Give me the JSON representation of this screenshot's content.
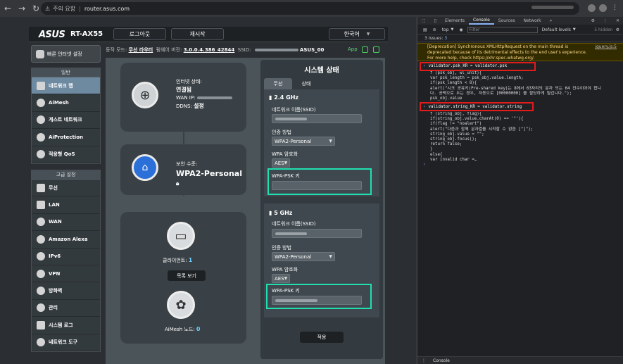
{
  "browser": {
    "security_label": "주의 요함",
    "url": "router.asus.com"
  },
  "router": {
    "brand": "ASUS",
    "model": "RT-AX55",
    "logout": "로그아웃",
    "reboot": "재시작",
    "language": "한국어",
    "status": {
      "mode_label": "동작 모드:",
      "mode_value": "무선 라우터",
      "fw_label": "펌웨어 버전:",
      "fw_value": "3.0.0.4.386_42844",
      "ssid_label": "SSID:",
      "ssid_value": "ASUS_00",
      "app": "App"
    },
    "quick_setup": "빠른 인터넷 설정",
    "general_header": "일반",
    "general_items": [
      "네트워크 맵",
      "AiMesh",
      "게스트 네트워크",
      "AiProtection",
      "적응형 QoS"
    ],
    "advanced_header": "고급 설정",
    "advanced_items": [
      "무선",
      "LAN",
      "WAN",
      "Amazon Alexa",
      "IPv6",
      "VPN",
      "방화벽",
      "관리",
      "시스템 로그",
      "네트워크 도구"
    ],
    "map": {
      "internet_status_label": "인터넷 상태:",
      "internet_status_value": "연결됨",
      "wan_ip_label": "WAN IP:",
      "ddns_label": "DDNS:",
      "ddns_value": "설정",
      "security_label": "보안 수준:",
      "security_value": "WPA2-Personal",
      "clients_label": "클라이언트:",
      "clients_value": "1",
      "list_button": "목록 보기",
      "aimesh_label": "AiMesh 노드:",
      "aimesh_value": "0"
    },
    "sys": {
      "title": "시스템 상태",
      "tab_wireless": "무선",
      "tab_status": "상태",
      "band24": "2.4 GHz",
      "band5": "5 GHz",
      "ssid_label": "네트워크 이름(SSID)",
      "auth_label": "인증 방법",
      "auth_value": "WPA2-Personal",
      "enc_label": "WPA 암호화",
      "enc_value": "AES",
      "psk_label": "WPA-PSK 키",
      "apply": "적용"
    }
  },
  "devtools": {
    "tabs": [
      "Elements",
      "Console",
      "Sources",
      "Network"
    ],
    "context": "top",
    "filter_placeholder": "Filter",
    "levels": "Default levels",
    "hidden": "5 hidden",
    "issues_label": "3 Issues:",
    "issues_count": "3",
    "warning_line1": "[Deprecation] Synchronous XMLHttpRequest on the main thread is",
    "warning_link": "jquery.js:5",
    "warning_line2": "deprecated because of its detrimental effects to the end user's experience.",
    "warning_line3": "For more help, check https://xhr.spec.whatwg.org/.",
    "cmd1": "validator.psk_KR = validator.psk",
    "code1": "f (psk_obj, wl_unit){\nvar psk_length = psk_obj.value.length;\nif(psk_length < 8){\nalert(\"시크 공유키(Pre-shared key)는 8에서 63자리의 문자 또는 64 진수이어야 합니\n다. 공백으로 두는 경우, 자동으로 [00000000] 을 할당하게 될겁니다.\");\npsk_obj.value",
    "cmd2": "validator.string_KR = validator.string",
    "code2": "f (string_obj, flag){\nif(string_obj.value.charAt(0) == '\"'){\nif(flag != \"noalert\")\nalert(\"다음과 함께 문자열을 시작할 수 없음 [\"]\");\nstring_obj.value = \"\";\nstring_obj.focus();\nreturn false;\n}\nelse{\nvar invalid_char =…",
    "drawer_tab": "Console"
  }
}
